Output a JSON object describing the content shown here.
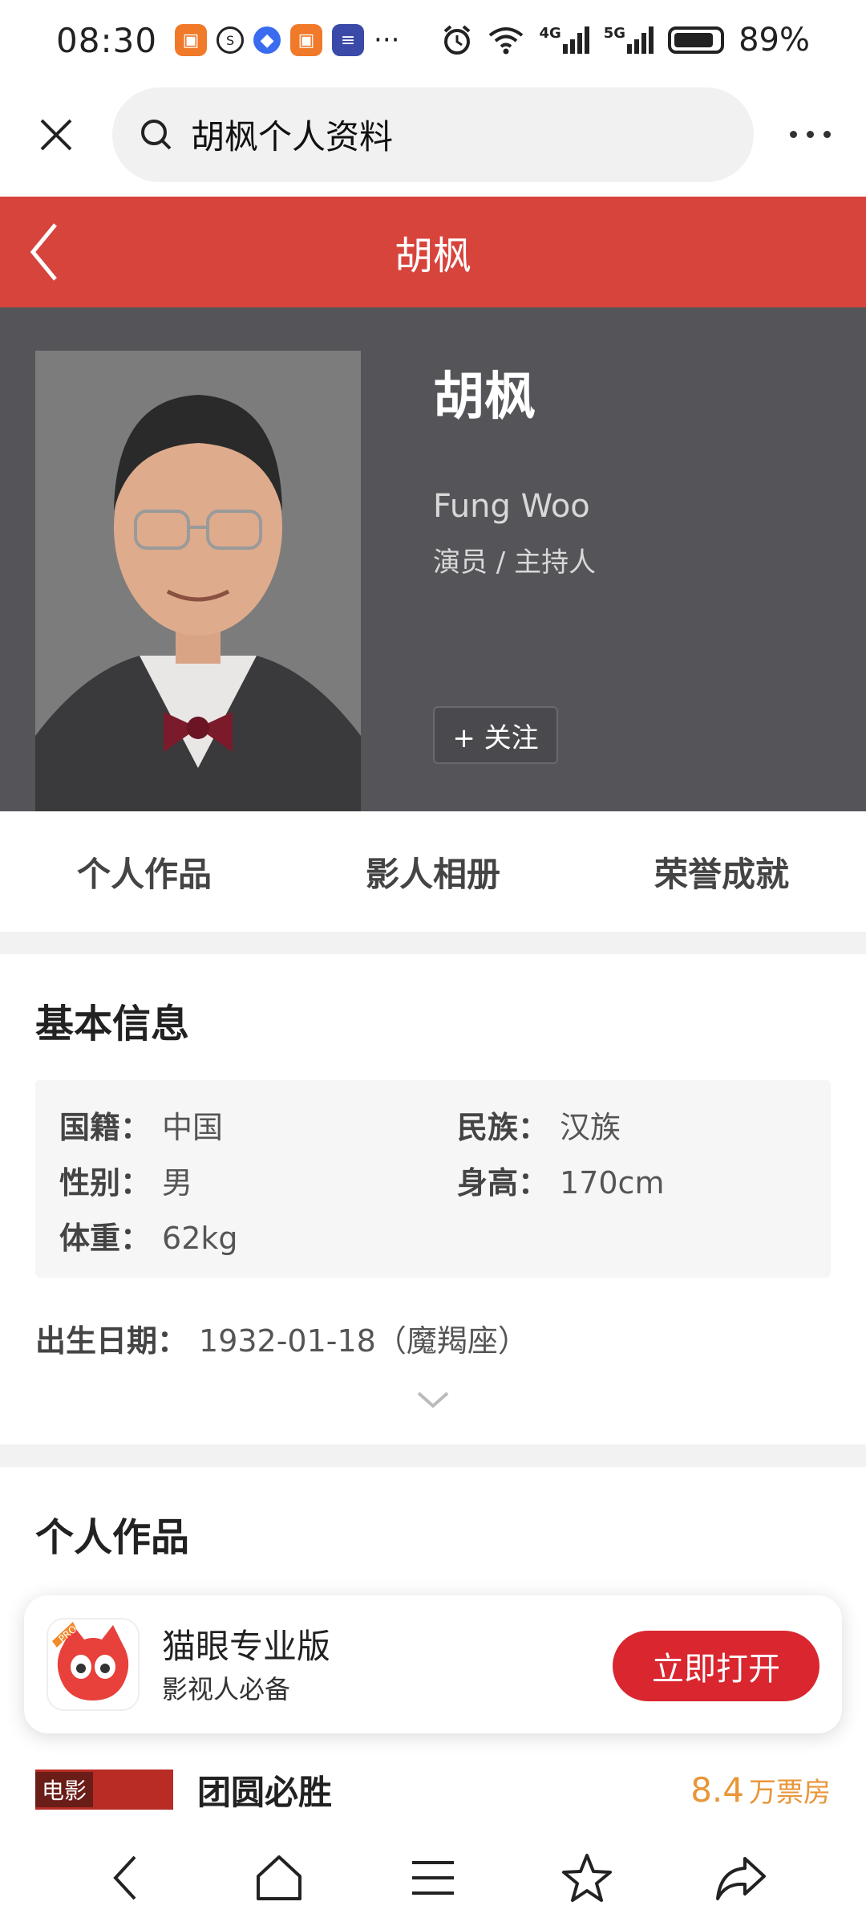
{
  "status_bar": {
    "time": "08:30",
    "network_4g": "4G",
    "network_5g": "5G",
    "battery": "89%"
  },
  "browser": {
    "search_text": "胡枫个人资料"
  },
  "title_bar": {
    "title": "胡枫"
  },
  "profile": {
    "name": "胡枫",
    "english_name": "Fung Woo",
    "roles": "演员 / 主持人",
    "follow_label": "+ 关注"
  },
  "tabs": [
    {
      "label": "个人作品"
    },
    {
      "label": "影人相册"
    },
    {
      "label": "荣誉成就"
    }
  ],
  "basic_info": {
    "section_title": "基本信息",
    "nationality_key": "国籍：",
    "nationality_val": "中国",
    "ethnicity_key": "民族：",
    "ethnicity_val": "汉族",
    "gender_key": "性别：",
    "gender_val": "男",
    "height_key": "身高：",
    "height_val": "170cm",
    "weight_key": "体重：",
    "weight_val": "62kg",
    "birth_key": "出生日期：",
    "birth_val": "1932-01-18（魔羯座）"
  },
  "works_section": {
    "section_title": "个人作品"
  },
  "app_banner": {
    "name": "猫眼专业版",
    "desc": "影视人必备",
    "open_label": "立即打开",
    "badge": "PRO"
  },
  "work_item": {
    "badge": "电影",
    "title": "团圆必胜",
    "box_num": "8.4",
    "box_unit": "万票房"
  },
  "colors": {
    "brand_red": "#d6443c",
    "header_gray": "#555559",
    "box_office_orange": "#e8963a",
    "open_button_red": "#d9262f"
  }
}
